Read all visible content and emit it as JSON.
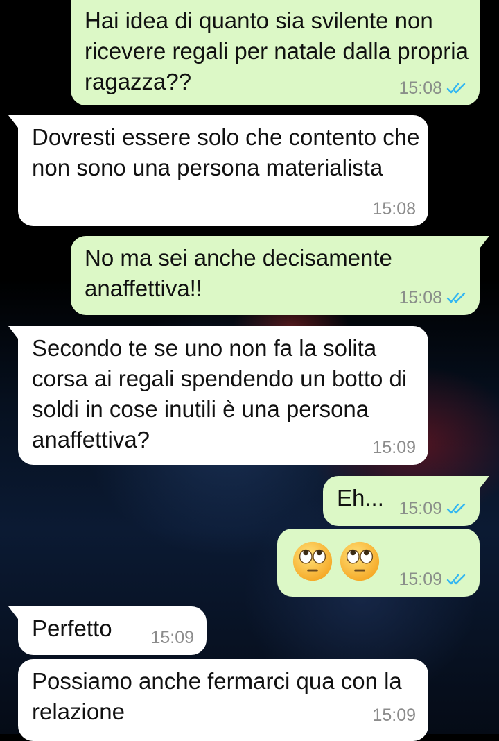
{
  "accent": {
    "sent_bg": "#dcf8c6",
    "recv_bg": "#ffffff",
    "read_ticks": "#34b7f1"
  },
  "messages": [
    {
      "dir": "out",
      "text": "Hai idea di quanto sia svilente non ricevere regali per natale dalla propria ragazza??",
      "time": "15:08",
      "status": "read-ticks-icon"
    },
    {
      "dir": "in",
      "text": "Dovresti essere solo che contento che non sono una persona materialista",
      "time": "15:08"
    },
    {
      "dir": "out",
      "text": "No ma sei anche decisamente anaffettiva!!",
      "time": "15:08",
      "status": "read-ticks-icon"
    },
    {
      "dir": "in",
      "text": "Secondo te se uno non fa la solita corsa ai regali spendendo un botto di soldi in cose inutili è una persona anaffettiva?",
      "time": "15:09"
    },
    {
      "dir": "out",
      "text": "Eh...",
      "time": "15:09",
      "status": "read-ticks-icon"
    },
    {
      "dir": "out",
      "emoji": [
        "face-with-rolling-eyes",
        "face-with-rolling-eyes"
      ],
      "time": "15:09",
      "status": "read-ticks-icon"
    },
    {
      "dir": "in",
      "text": "Perfetto",
      "time": "15:09"
    },
    {
      "dir": "in",
      "text": "Possiamo anche fermarci qua con la relazione",
      "time": "15:09"
    }
  ]
}
